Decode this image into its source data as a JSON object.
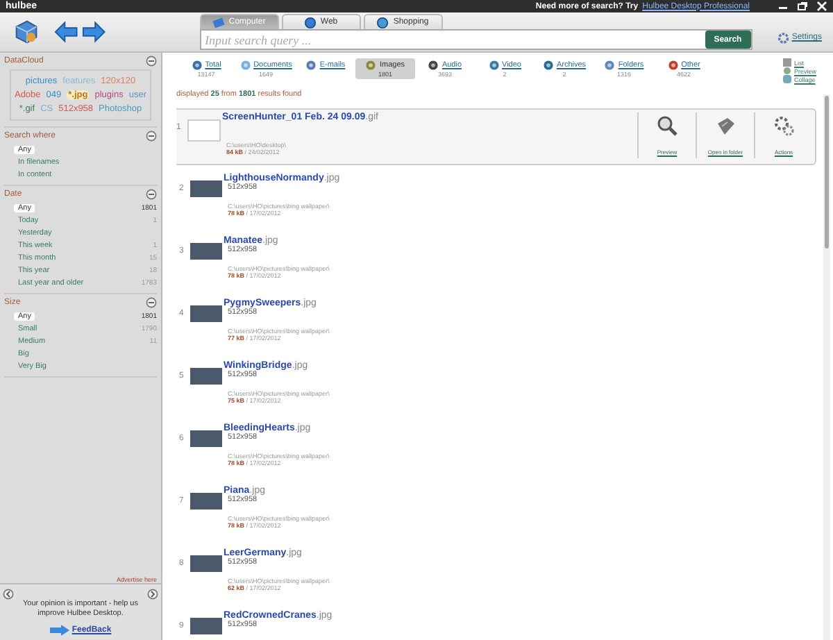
{
  "title_bar": {
    "logo": "hulbee",
    "promo_text": "Need more of search? Try",
    "promo_link": "Hulbee Desktop Professional"
  },
  "toolbar": {
    "tabs": [
      {
        "label": "Computer",
        "selected": true,
        "kind": "computer"
      },
      {
        "label": "Web",
        "selected": false,
        "kind": "web"
      },
      {
        "label": "Shopping",
        "selected": false,
        "kind": "shopping"
      }
    ],
    "search": {
      "placeholder": "Input search query ..."
    },
    "search_button": "Search",
    "settings_link": "Settings"
  },
  "sidebar": {
    "datacloud": {
      "title": "DataCloud",
      "expanded": true,
      "tags": [
        {
          "label": "pictures",
          "color": "#3a8fc0",
          "selected": false
        },
        {
          "label": "features",
          "color": "#8ab8d8",
          "selected": false
        },
        {
          "label": "120x120",
          "color": "#e0805a",
          "selected": false
        },
        {
          "label": "Adobe",
          "color": "#d05a4a",
          "selected": false
        },
        {
          "label": "049",
          "color": "#3a8fc0",
          "selected": false
        },
        {
          "label": "*.jpg",
          "color": "#b87820",
          "selected": true
        },
        {
          "label": "plugins",
          "color": "#b04a80",
          "selected": false
        },
        {
          "label": "user",
          "color": "#5a90c8",
          "selected": false
        },
        {
          "label": "*.gif",
          "color": "#3a7a5a",
          "selected": false
        },
        {
          "label": "CS",
          "color": "#80b0d0",
          "selected": false
        },
        {
          "label": "512x958",
          "color": "#d05a5a",
          "selected": false
        },
        {
          "label": "Photoshop",
          "color": "#4a9ac0",
          "selected": false
        }
      ]
    },
    "filters": [
      {
        "title": "Search where",
        "expanded": true,
        "options": [
          {
            "label": "Any",
            "selected": true
          },
          {
            "label": "In filenames",
            "selected": false
          },
          {
            "label": "In content",
            "selected": false
          }
        ]
      },
      {
        "title": "Date",
        "expanded": true,
        "options": [
          {
            "label": "Any",
            "count": "1801",
            "selected": true
          },
          {
            "label": "Today",
            "count": "1",
            "selected": false
          },
          {
            "label": "Yesterday",
            "selected": false
          },
          {
            "label": "This week",
            "count": "1",
            "selected": false
          },
          {
            "label": "This month",
            "count": "15",
            "selected": false
          },
          {
            "label": "This year",
            "count": "18",
            "selected": false
          },
          {
            "label": "Last year and older",
            "count": "1783",
            "selected": false
          }
        ]
      },
      {
        "title": "Size",
        "expanded": true,
        "options": [
          {
            "label": "Any",
            "count": "1801",
            "selected": true
          },
          {
            "label": "Small",
            "count": "1790",
            "selected": false
          },
          {
            "label": "Medium",
            "count": "11",
            "selected": false
          },
          {
            "label": "Big",
            "selected": false
          },
          {
            "label": "Very Big",
            "selected": false
          }
        ]
      }
    ],
    "advertise_link": "Advertise here",
    "feedback": {
      "text": "Your opinion is important - help us improve Hulbee Desktop.",
      "link": "FeedBack"
    }
  },
  "categories": [
    {
      "label": "Total",
      "count": "13147",
      "kind": "total",
      "selected": false
    },
    {
      "label": "Documents",
      "count": "1649",
      "kind": "documents",
      "selected": false
    },
    {
      "label": "E-mails",
      "kind": "emails",
      "selected": false
    },
    {
      "label": "Images",
      "count": "1801",
      "kind": "images",
      "selected": true
    },
    {
      "label": "Audio",
      "count": "3693",
      "kind": "audio",
      "selected": false
    },
    {
      "label": "Video",
      "count": "2",
      "kind": "video",
      "selected": false
    },
    {
      "label": "Archives",
      "count": "2",
      "kind": "archives",
      "selected": false
    },
    {
      "label": "Folders",
      "count": "1316",
      "kind": "folders",
      "selected": false
    },
    {
      "label": "Other",
      "count": "4622",
      "kind": "other",
      "selected": false
    }
  ],
  "view_options": [
    {
      "label": "List",
      "kind": "list"
    },
    {
      "label": "Preview",
      "kind": "preview"
    },
    {
      "label": "Collage",
      "kind": "collage"
    }
  ],
  "summary": {
    "prefix": "displayed",
    "shown": "25",
    "middle": "from",
    "total": "1801",
    "suffix": "results found"
  },
  "results": [
    {
      "number": "1",
      "name": "ScreenHunter_01 Feb. 24 09.09",
      "ext": ".gif",
      "path": "C:\\users\\HO\\desktop\\",
      "size": "84 kB",
      "date": "/ 24/02/2012",
      "selected": true,
      "actions": [
        {
          "label": "Preview",
          "kind": "preview"
        },
        {
          "label": "Open in folder",
          "kind": "folder"
        },
        {
          "label": "Actions",
          "kind": "actions"
        }
      ]
    },
    {
      "number": "2",
      "name": "LighthouseNormandy",
      "ext": ".jpg",
      "dims": "512x958",
      "path": "C:\\users\\HO\\pictures\\bing wallpaper\\",
      "size": "78 kB",
      "date": "/ 17/02/2012",
      "selected": false
    },
    {
      "number": "3",
      "name": "Manatee",
      "ext": ".jpg",
      "dims": "512x958",
      "path": "C:\\users\\HO\\pictures\\bing wallpaper\\",
      "size": "78 kB",
      "date": "/ 17/02/2012",
      "selected": false
    },
    {
      "number": "4",
      "name": "PygmySweepers",
      "ext": ".jpg",
      "dims": "512x958",
      "path": "C:\\users\\HO\\pictures\\bing wallpaper\\",
      "size": "77 kB",
      "date": "/ 17/02/2012",
      "selected": false
    },
    {
      "number": "5",
      "name": "WinkingBridge",
      "ext": ".jpg",
      "dims": "512x958",
      "path": "C:\\users\\HO\\pictures\\bing wallpaper\\",
      "size": "75 kB",
      "date": "/ 17/02/2012",
      "selected": false
    },
    {
      "number": "6",
      "name": "BleedingHearts",
      "ext": ".jpg",
      "dims": "512x958",
      "path": "C:\\users\\HO\\pictures\\bing wallpaper\\",
      "size": "78 kB",
      "date": "/ 17/02/2012",
      "selected": false
    },
    {
      "number": "7",
      "name": "Piana",
      "ext": ".jpg",
      "dims": "512x958",
      "path": "C:\\users\\HO\\pictures\\bing wallpaper\\",
      "size": "78 kB",
      "date": "/ 17/02/2012",
      "selected": false
    },
    {
      "number": "8",
      "name": "LeerGermany",
      "ext": ".jpg",
      "dims": "512x958",
      "path": "C:\\users\\HO\\pictures\\bing wallpaper\\",
      "size": "62 kB",
      "date": "/ 17/02/2012",
      "selected": false
    },
    {
      "number": "9",
      "name": "RedCrownedCranes",
      "ext": ".jpg",
      "dims": "512x958",
      "selected": false
    }
  ]
}
